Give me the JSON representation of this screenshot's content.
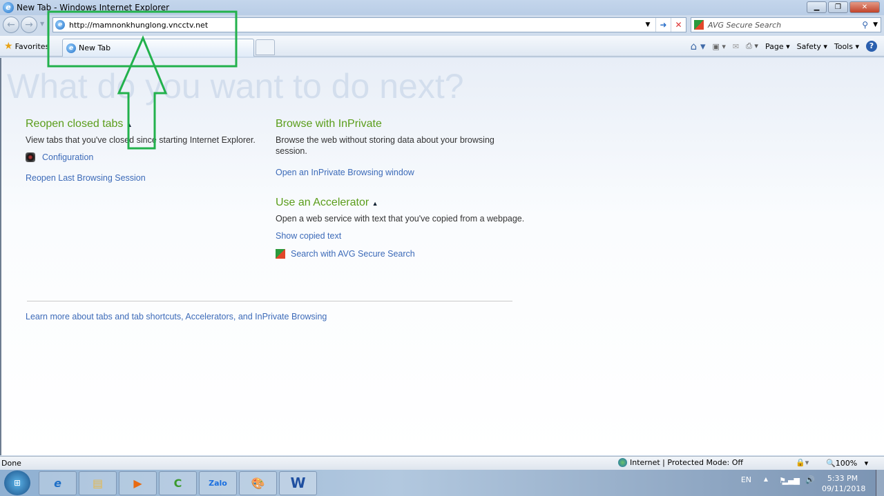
{
  "window": {
    "title": "New Tab - Windows Internet Explorer"
  },
  "address": {
    "url": "http://mamnonkhunglong.vncctv.net"
  },
  "search": {
    "placeholder": "AVG Secure Search"
  },
  "favorites": {
    "label": "Favorites"
  },
  "tab": {
    "label": "New Tab"
  },
  "commands": {
    "page": "Page",
    "safety": "Safety",
    "tools": "Tools"
  },
  "content": {
    "hero": "What do you want to do next?",
    "reopen": {
      "title": "Reopen closed tabs",
      "desc": "View tabs that you've closed since starting Internet Explorer.",
      "items": [
        "Configuration"
      ],
      "session": "Reopen Last Browsing Session"
    },
    "inprivate": {
      "title": "Browse with InPrivate",
      "desc": "Browse the web without storing data about your browsing session.",
      "link": "Open an InPrivate Browsing window"
    },
    "accelerator": {
      "title": "Use an Accelerator",
      "desc": "Open a web service with text that you've copied from a webpage.",
      "show": "Show copied text",
      "search": "Search with AVG Secure Search"
    },
    "learn": "Learn more about tabs and tab shortcuts, Accelerators, and InPrivate Browsing"
  },
  "status": {
    "left": "Done",
    "zone": "Internet | Protected Mode: Off",
    "zoom": "100%"
  },
  "tray": {
    "lang": "EN",
    "time": "5:33 PM",
    "date": "09/11/2018"
  },
  "taskbar": {
    "zalo": "Zalo"
  },
  "annotation": {
    "color": "#22b14c"
  }
}
